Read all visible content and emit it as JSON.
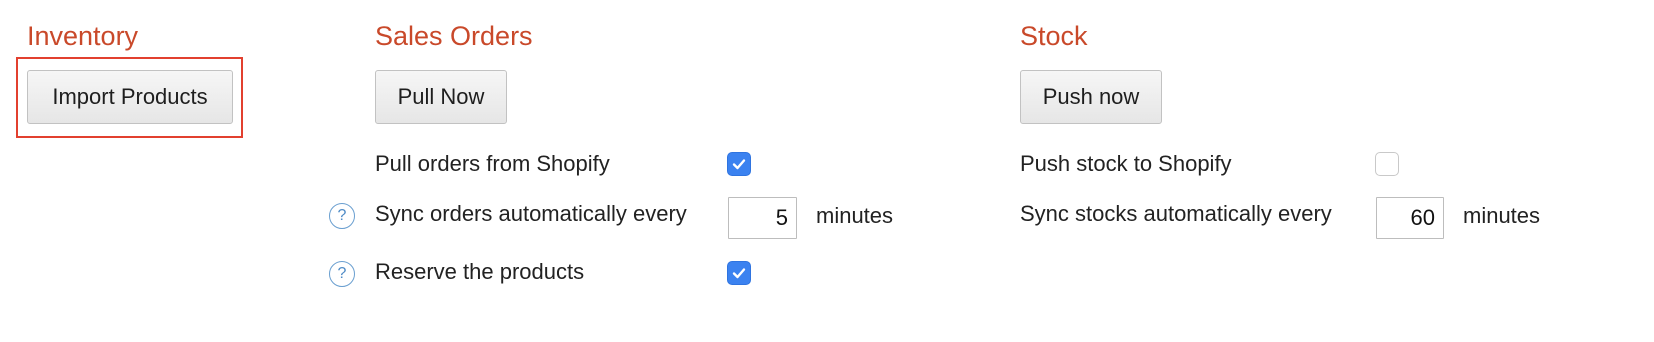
{
  "inventory": {
    "title": "Inventory",
    "import_button": "Import Products"
  },
  "sales_orders": {
    "title": "Sales Orders",
    "pull_button": "Pull Now",
    "pull_orders_label": "Pull orders from Shopify",
    "pull_orders_checked": true,
    "sync_label": "Sync orders automatically every",
    "sync_value": "5",
    "sync_unit": "minutes",
    "reserve_label": "Reserve the products",
    "reserve_checked": true,
    "help_glyph": "?"
  },
  "stock": {
    "title": "Stock",
    "push_button": "Push now",
    "push_stock_label": "Push stock to Shopify",
    "push_stock_checked": false,
    "sync_label": "Sync stocks automatically every",
    "sync_value": "60",
    "sync_unit": "minutes"
  },
  "colors": {
    "heading": "#c9492a",
    "highlight": "#e2402f",
    "checkbox_checked": "#3b82f0",
    "help_icon": "#4d8ac6"
  },
  "icons": {
    "help": "question-circle-icon",
    "check": "checkmark-icon"
  }
}
